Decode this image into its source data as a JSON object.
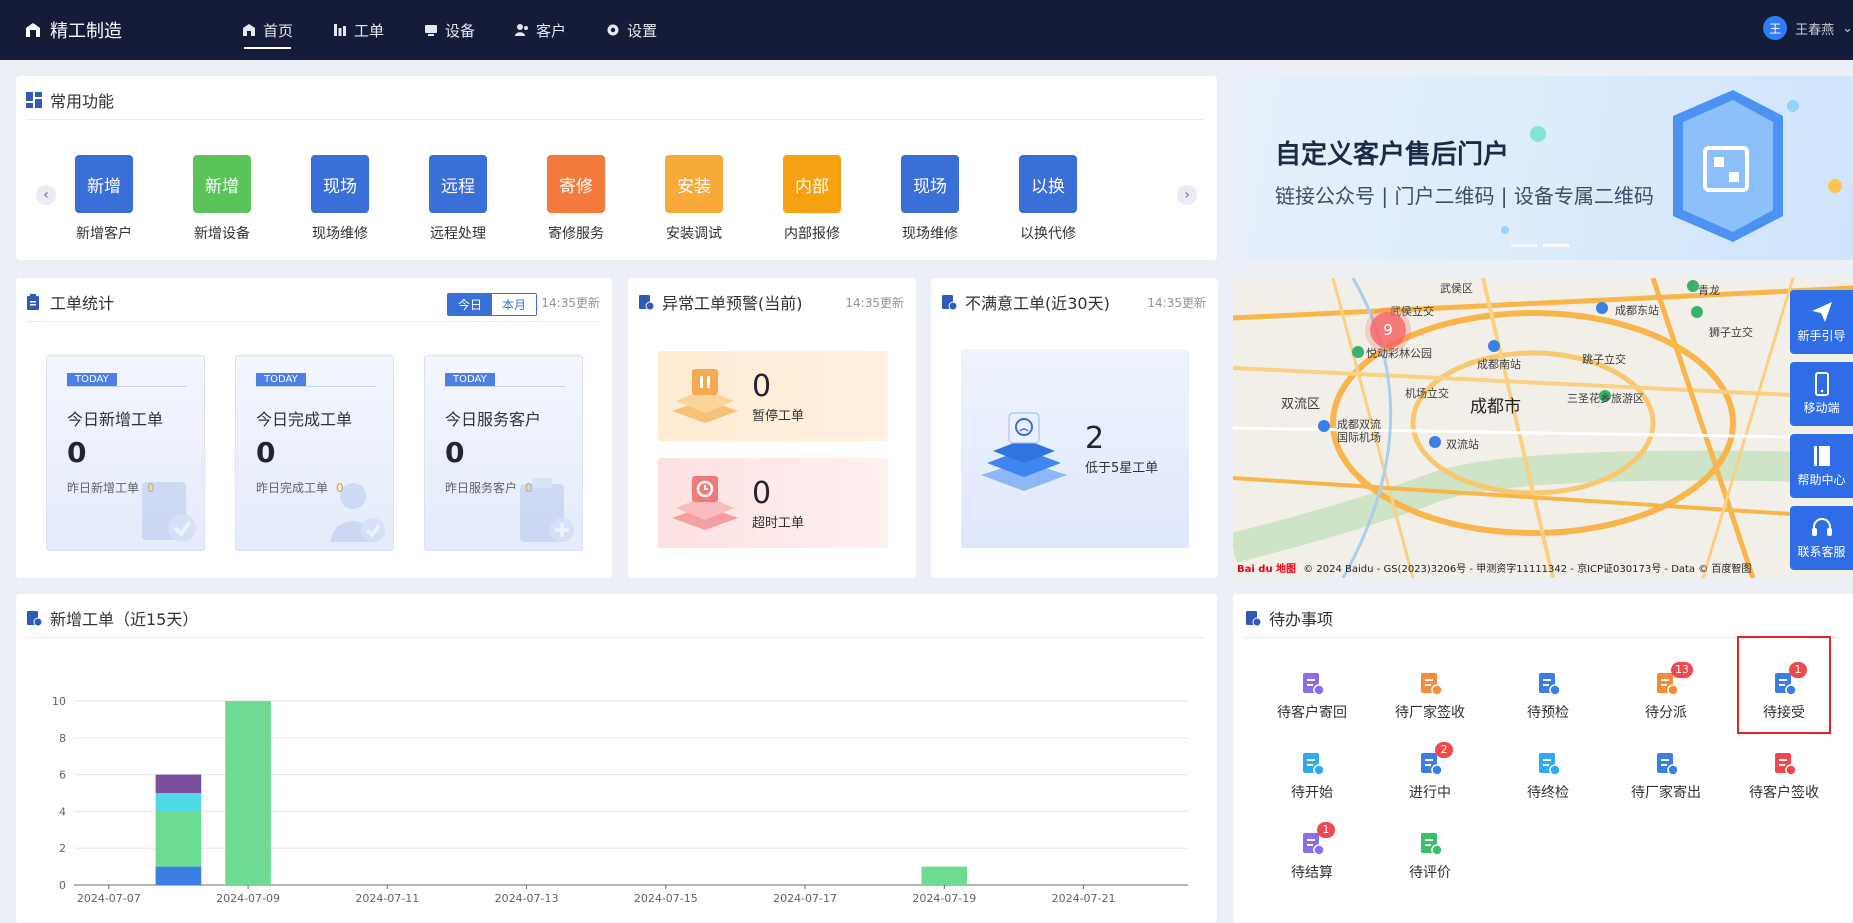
{
  "brand": {
    "name": "精工制造"
  },
  "nav": [
    {
      "label": "首页",
      "icon": "home-icon",
      "active": true
    },
    {
      "label": "工单",
      "icon": "workorder-icon"
    },
    {
      "label": "设备",
      "icon": "device-icon"
    },
    {
      "label": "客户",
      "icon": "customer-icon"
    },
    {
      "label": "设置",
      "icon": "settings-icon"
    }
  ],
  "user": {
    "avatar": "王",
    "name": "王春燕"
  },
  "quick": {
    "title": "常用功能",
    "items": [
      {
        "tile": "新增",
        "label": "新增客户",
        "color": "#3a6fd8"
      },
      {
        "tile": "新增",
        "label": "新增设备",
        "color": "#5ac35a"
      },
      {
        "tile": "现场",
        "label": "现场维修",
        "color": "#3a6fd8"
      },
      {
        "tile": "远程",
        "label": "远程处理",
        "color": "#3a6fd8"
      },
      {
        "tile": "寄修",
        "label": "寄修服务",
        "color": "#f47b3c"
      },
      {
        "tile": "安装",
        "label": "安装调试",
        "color": "#f7a93a"
      },
      {
        "tile": "内部",
        "label": "内部报修",
        "color": "#f7a012"
      },
      {
        "tile": "现场",
        "label": "现场维修",
        "color": "#3a6fd8"
      },
      {
        "tile": "以换",
        "label": "以换代修",
        "color": "#3a6fd8"
      }
    ]
  },
  "banner": {
    "title": "自定义客户售后门户",
    "subtitle": "链接公众号 | 门户二维码 | 设备专属二维码"
  },
  "stats": {
    "title": "工单统计",
    "tabs": [
      "今日",
      "本月"
    ],
    "updated": "14:35更新",
    "tag": "TODAY",
    "boxes": [
      {
        "title": "今日新增工单",
        "value": "0",
        "sub": "昨日新增工单",
        "sub_value": "0"
      },
      {
        "title": "今日完成工单",
        "value": "0",
        "sub": "昨日完成工单",
        "sub_value": "0"
      },
      {
        "title": "今日服务客户",
        "value": "0",
        "sub": "昨日服务客户",
        "sub_value": "0"
      }
    ]
  },
  "abnormal": {
    "title": "异常工单预警(当前)",
    "updated": "14:35更新",
    "items": [
      {
        "value": "0",
        "label": "暂停工单"
      },
      {
        "value": "0",
        "label": "超时工单"
      }
    ]
  },
  "unsatisfied": {
    "title": "不满意工单(近30天)",
    "updated": "14:35更新",
    "value": "2",
    "label": "低于5星工单"
  },
  "map": {
    "cluster_count": "9",
    "labels": [
      {
        "text": "武侯区"
      },
      {
        "text": "武侯立交"
      },
      {
        "text": "成都东站"
      },
      {
        "text": "青龙"
      },
      {
        "text": "狮子立交"
      },
      {
        "text": "悦动彩林公园"
      },
      {
        "text": "成都南站"
      },
      {
        "text": "跳子立交"
      },
      {
        "text": "双流区"
      },
      {
        "text": "机场立交"
      },
      {
        "text": "成都市"
      },
      {
        "text": "三圣花乡旅游区"
      },
      {
        "text": "成都双流"
      },
      {
        "text": "国际机场"
      },
      {
        "text": "双流站"
      }
    ],
    "copyright": "© 2024 Baidu - GS(2023)3206号 - 甲测资字11111342 - 京ICP证030173号 - Data © 百度智图",
    "logo": "Bai du 地图"
  },
  "side_tools": [
    {
      "label": "新手引导",
      "icon": "send-icon"
    },
    {
      "label": "移动端",
      "icon": "mobile-icon"
    },
    {
      "label": "帮助中心",
      "icon": "book-icon"
    },
    {
      "label": "联系客服",
      "icon": "headset-icon"
    }
  ],
  "trend": {
    "title": "新增工单（近15天）"
  },
  "chart_data": {
    "type": "bar",
    "stacked": true,
    "categories": [
      "2024-07-07",
      "2024-07-08",
      "2024-07-09",
      "2024-07-10",
      "2024-07-11",
      "2024-07-12",
      "2024-07-13",
      "2024-07-14",
      "2024-07-15",
      "2024-07-16",
      "2024-07-17",
      "2024-07-18",
      "2024-07-19",
      "2024-07-20",
      "2024-07-21",
      "2024-07-22"
    ],
    "tick_labels": [
      "2024-07-07",
      "2024-07-09",
      "2024-07-11",
      "2024-07-13",
      "2024-07-15",
      "2024-07-17",
      "2024-07-19",
      "2024-07-21"
    ],
    "series": [
      {
        "color": "#3b7fe6",
        "values": [
          0,
          1,
          0,
          0,
          0,
          0,
          0,
          0,
          0,
          0,
          0,
          0,
          0,
          0,
          0,
          0
        ]
      },
      {
        "color": "#6ddc91",
        "values": [
          0,
          3,
          10,
          0,
          0,
          0,
          0,
          0,
          0,
          0,
          0,
          0,
          1,
          0,
          0,
          0
        ]
      },
      {
        "color": "#4fd9e8",
        "values": [
          0,
          1,
          0,
          0,
          0,
          0,
          0,
          0,
          0,
          0,
          0,
          0,
          0,
          0,
          0,
          0
        ]
      },
      {
        "color": "#7b4f9c",
        "values": [
          0,
          1,
          0,
          0,
          0,
          0,
          0,
          0,
          0,
          0,
          0,
          0,
          0,
          0,
          0,
          0
        ]
      }
    ],
    "ylim": [
      0,
      10
    ],
    "yticks": [
      0,
      2,
      4,
      6,
      8,
      10
    ],
    "grid": true
  },
  "todo": {
    "title": "待办事项",
    "items": [
      {
        "label": "待客户寄回",
        "icon": "return-icon",
        "color": "#8a6cf0",
        "badge": ""
      },
      {
        "label": "待厂家签收",
        "icon": "sign-icon",
        "color": "#f48b3a",
        "badge": ""
      },
      {
        "label": "待预检",
        "icon": "precheck-icon",
        "color": "#3b7fe6",
        "badge": ""
      },
      {
        "label": "待分派",
        "icon": "dispatch-icon",
        "color": "#f48b3a",
        "badge": "13"
      },
      {
        "label": "待接受",
        "icon": "inbox-icon",
        "color": "#3b7fe6",
        "badge": "1",
        "highlight": true
      },
      {
        "label": "待开始",
        "icon": "start-icon",
        "color": "#2eaaf2",
        "badge": ""
      },
      {
        "label": "进行中",
        "icon": "progress-icon",
        "color": "#3b7fe6",
        "badge": "2"
      },
      {
        "label": "待终检",
        "icon": "finalcheck-icon",
        "color": "#2eaaf2",
        "badge": ""
      },
      {
        "label": "待厂家寄出",
        "icon": "ship-icon",
        "color": "#3b7fe6",
        "badge": ""
      },
      {
        "label": "待客户签收",
        "icon": "customer-sign-icon",
        "color": "#f0484e",
        "badge": ""
      },
      {
        "label": "待结算",
        "icon": "settle-icon",
        "color": "#8a6cf0",
        "badge": "1"
      },
      {
        "label": "待评价",
        "icon": "review-icon",
        "color": "#3bbf6a",
        "badge": ""
      }
    ]
  }
}
